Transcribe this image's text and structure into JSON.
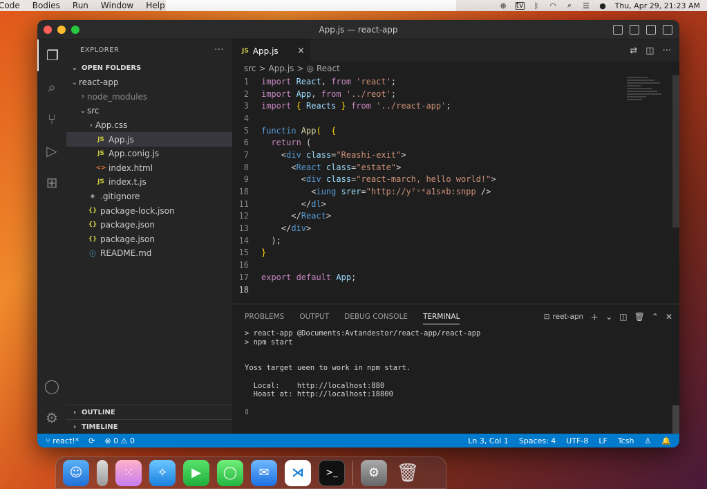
{
  "menubar": {
    "items": [
      "Code",
      "Bodies",
      "Run",
      "Window",
      "Help"
    ],
    "clock": "Thu, Apr 29, 21:23 AM",
    "tv_label": "tv"
  },
  "window": {
    "title": "App.js — react-app"
  },
  "sidebar": {
    "header": "EXPLORER",
    "more": "···",
    "section": "OPEN FOLDERS",
    "tree": [
      {
        "label": "react-app",
        "depth": 0,
        "chevron": "⌄",
        "icon": "",
        "type": "folder"
      },
      {
        "label": "node_modules",
        "depth": 1,
        "chevron": "›",
        "icon": "",
        "type": "folder",
        "dim": true
      },
      {
        "label": "src",
        "depth": 1,
        "chevron": "⌄",
        "icon": "",
        "type": "folder"
      },
      {
        "label": "App.css",
        "depth": 2,
        "chevron": "›",
        "icon": "",
        "type": "folder"
      },
      {
        "label": "App.js",
        "depth": 2,
        "chevron": "",
        "icon": "JS",
        "type": "js",
        "selected": true
      },
      {
        "label": "App.conig.js",
        "depth": 2,
        "chevron": "",
        "icon": "JS",
        "type": "js"
      },
      {
        "label": "index.html",
        "depth": 2,
        "chevron": "",
        "icon": "<>",
        "type": "html"
      },
      {
        "label": "index.t.js",
        "depth": 2,
        "chevron": "",
        "icon": "JS",
        "type": "js"
      },
      {
        "label": ".gitignore",
        "depth": 1,
        "chevron": "",
        "icon": "◆",
        "type": "git"
      },
      {
        "label": "package-lock.json",
        "depth": 1,
        "chevron": "",
        "icon": "{}",
        "type": "json"
      },
      {
        "label": "package.json",
        "depth": 1,
        "chevron": "",
        "icon": "{}",
        "type": "json"
      },
      {
        "label": "package.json",
        "depth": 1,
        "chevron": "",
        "icon": "{}",
        "type": "json"
      },
      {
        "label": "README.md",
        "depth": 1,
        "chevron": "",
        "icon": "ⓘ",
        "type": "info"
      }
    ],
    "outline": "OUTLINE",
    "timeline": "TIMELINE"
  },
  "editor": {
    "tab": {
      "icon": "JS",
      "label": "App.js",
      "close": "×"
    },
    "breadcrumb": [
      "src",
      ">",
      "App.js",
      ">",
      "React"
    ],
    "lines": [
      {
        "n": "1",
        "tokens": [
          [
            "kw2",
            "import "
          ],
          [
            "id",
            "React"
          ],
          [
            "pl",
            ", "
          ],
          [
            "kw2",
            "from "
          ],
          [
            "str",
            "'react'"
          ],
          [
            "pl",
            ";"
          ]
        ]
      },
      {
        "n": "2",
        "tokens": [
          [
            "kw2",
            "import "
          ],
          [
            "id",
            "App"
          ],
          [
            "pl",
            ", "
          ],
          [
            "kw2",
            "from "
          ],
          [
            "str",
            "'../reot'"
          ],
          [
            "pl",
            ";"
          ]
        ]
      },
      {
        "n": "3",
        "tokens": [
          [
            "kw2",
            "import "
          ],
          [
            "brk",
            "{ "
          ],
          [
            "id",
            "Reacts"
          ],
          [
            "brk",
            " }"
          ],
          [
            "kw2",
            " from "
          ],
          [
            "str",
            "'../react-app'"
          ],
          [
            "pl",
            ";"
          ]
        ]
      },
      {
        "n": "4",
        "tokens": []
      },
      {
        "n": "5",
        "tokens": [
          [
            "kw",
            "functin "
          ],
          [
            "fn",
            "App"
          ],
          [
            "brk",
            "("
          ],
          [
            "pl",
            "  "
          ],
          [
            "brk",
            "{"
          ]
        ]
      },
      {
        "n": "6",
        "tokens": [
          [
            "pl",
            "  "
          ],
          [
            "kw2",
            "return "
          ],
          [
            "pl",
            "("
          ]
        ]
      },
      {
        "n": "7",
        "tokens": [
          [
            "pl",
            "    "
          ],
          [
            "pl",
            "<"
          ],
          [
            "tag",
            "div "
          ],
          [
            "attr",
            "class"
          ],
          [
            "pl",
            "="
          ],
          [
            "str",
            "\"Reashi-exit\""
          ],
          [
            "pl",
            ">"
          ]
        ]
      },
      {
        "n": "8",
        "tokens": [
          [
            "pl",
            "      "
          ],
          [
            "pl",
            "<"
          ],
          [
            "tag",
            "React "
          ],
          [
            "attr",
            "class"
          ],
          [
            "pl",
            "="
          ],
          [
            "str",
            "\"estate\""
          ],
          [
            "pl",
            ">"
          ]
        ]
      },
      {
        "n": "9",
        "tokens": [
          [
            "pl",
            "        "
          ],
          [
            "pl",
            "<"
          ],
          [
            "tag",
            "div "
          ],
          [
            "attr",
            "class"
          ],
          [
            "pl",
            "="
          ],
          [
            "str",
            "\"react-march, hello world!\""
          ],
          [
            "pl",
            ">"
          ]
        ]
      },
      {
        "n": "18",
        "tokens": [
          [
            "pl",
            "          "
          ],
          [
            "pl",
            "<"
          ],
          [
            "tag",
            "iung "
          ],
          [
            "attr",
            "srer"
          ],
          [
            "pl",
            "="
          ],
          [
            "str",
            "\"http://y⁷ᵛ⁴a1s×b:snpp"
          ],
          [
            "pl",
            " />"
          ]
        ]
      },
      {
        "n": "11",
        "tokens": [
          [
            "pl",
            "        "
          ],
          [
            "pl",
            "</"
          ],
          [
            "tag",
            "dl"
          ],
          [
            "pl",
            ">"
          ]
        ]
      },
      {
        "n": "12",
        "tokens": [
          [
            "pl",
            "      "
          ],
          [
            "pl",
            "</"
          ],
          [
            "tag",
            "React"
          ],
          [
            "pl",
            ">"
          ]
        ]
      },
      {
        "n": "13",
        "tokens": [
          [
            "pl",
            "    "
          ],
          [
            "pl",
            "</"
          ],
          [
            "tag",
            "div"
          ],
          [
            "pl",
            ">"
          ]
        ]
      },
      {
        "n": "14",
        "tokens": [
          [
            "pl",
            "  );"
          ]
        ]
      },
      {
        "n": "15",
        "tokens": [
          [
            "brk",
            "}"
          ]
        ]
      },
      {
        "n": "16",
        "tokens": []
      },
      {
        "n": "17",
        "tokens": [
          [
            "kw2",
            "export "
          ],
          [
            "kw2",
            "default "
          ],
          [
            "id",
            "App"
          ],
          [
            "pl",
            ";"
          ]
        ]
      },
      {
        "n": "18",
        "tokens": [],
        "current": true
      }
    ]
  },
  "panel": {
    "tabs": [
      "PROBLEMS",
      "OUTPUT",
      "DEBUG CONSOLE",
      "TERMINAL"
    ],
    "active_tab": "TERMINAL",
    "terminal_name": "reet-apn",
    "terminal_lines": [
      "> react-app @Documents:Avtandestor/react-app/react-app",
      "> npm start",
      "",
      "",
      "Yoss target ueen to work in npm start.",
      "",
      "  Local:    http://localhost:880",
      "  Hoast at: http://localhost:18800",
      "",
      "▯"
    ]
  },
  "statusbar": {
    "branch": "react!*",
    "errors": "0",
    "warnings": "0",
    "position": "Ln 3, Col 1",
    "spaces": "Spaces: 4",
    "encoding": "UTF-8",
    "eol": "LF",
    "language": "Tcsh"
  },
  "dock": {
    "apps": [
      "finder-icon",
      "launchpad-pill-icon",
      "launchpad-icon",
      "safari-icon",
      "facetime-icon",
      "messages-icon",
      "mail-icon",
      "vscode-icon",
      "terminal-icon",
      "system-settings-icon",
      "trash-icon"
    ]
  }
}
